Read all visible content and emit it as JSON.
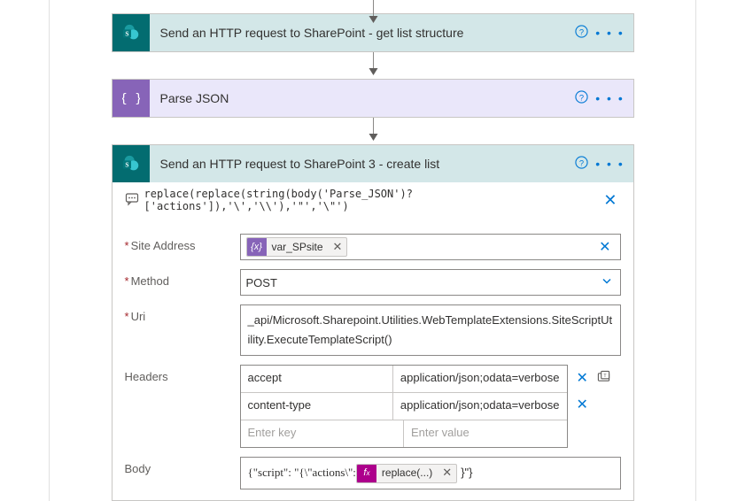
{
  "steps": {
    "s1": {
      "title": "Send an HTTP request to SharePoint - get list structure"
    },
    "s2": {
      "title": "Parse JSON"
    },
    "s3": {
      "title": "Send an HTTP request to SharePoint 3 - create list"
    }
  },
  "s3": {
    "peek_expression": "replace(replace(string(body('Parse_JSON')?['actions']),'\\','\\\\'),'\"','\\\"')",
    "labels": {
      "siteAddress": "Site Address",
      "method": "Method",
      "uri": "Uri",
      "headers": "Headers",
      "body": "Body"
    },
    "siteAddress": {
      "token": "var_SPsite"
    },
    "method": {
      "value": "POST"
    },
    "uri": {
      "value": "_api/Microsoft.Sharepoint.Utilities.WebTemplateExtensions.SiteScriptUtility.ExecuteTemplateScript()"
    },
    "headers": {
      "rows": [
        {
          "key": "accept",
          "value": "application/json;odata=verbose"
        },
        {
          "key": "content-type",
          "value": "application/json;odata=verbose"
        }
      ],
      "placeholderKey": "Enter key",
      "placeholderValue": "Enter value"
    },
    "body": {
      "prefix": "{\"script\": \"{\\\"actions\\\":",
      "token": "replace(...)",
      "suffix": "}\"}"
    }
  },
  "aria": {
    "help": "Help",
    "more": "More",
    "close": "Close",
    "remove": "Remove",
    "switchMode": "Switch to text mode"
  }
}
